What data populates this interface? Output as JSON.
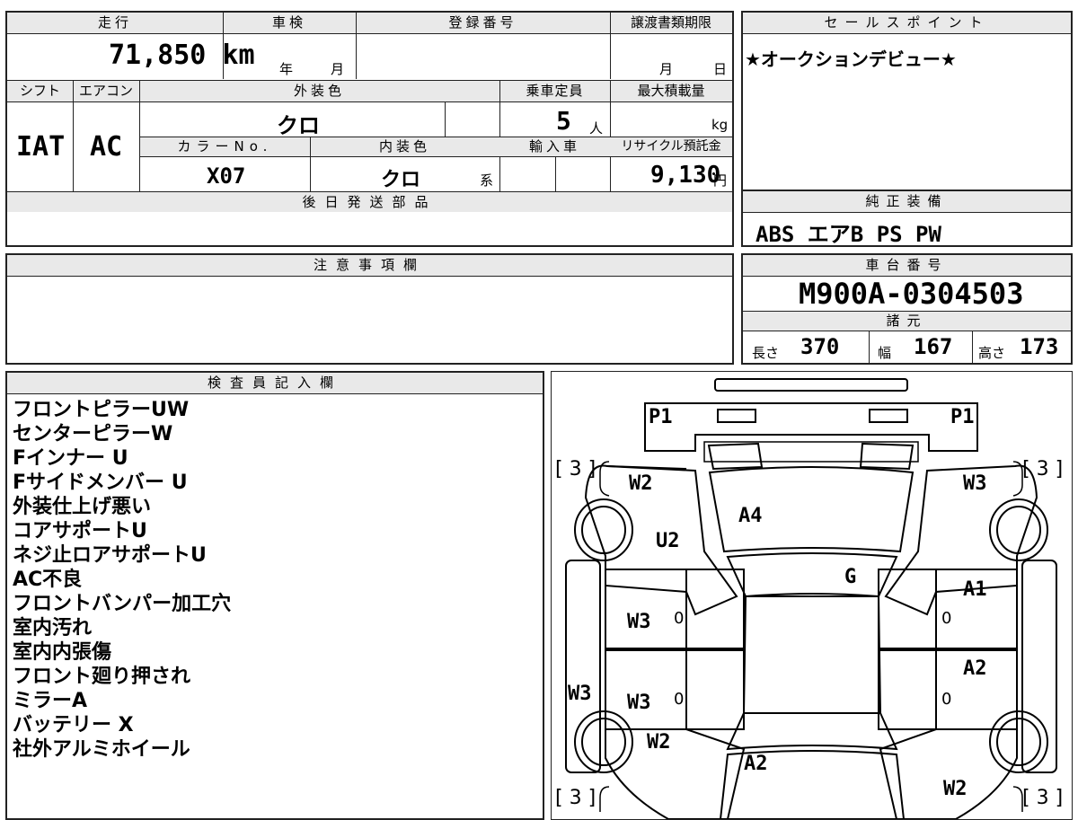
{
  "top_left": {
    "labels": {
      "mileage": "走行",
      "inspection": "車検",
      "registration": "登録番号",
      "transfer_deadline": "譲渡書類期限",
      "shift": "シフト",
      "aircon": "エアコン",
      "exterior_color": "外装色",
      "capacity": "乗車定員",
      "max_load": "最大積載量",
      "color_no": "カラーNo.",
      "interior_color": "内装色",
      "import": "輸入車",
      "recycle": "リサイクル預託金"
    },
    "values": {
      "mileage": "71,850 km",
      "year_unit": "年",
      "month_unit": "月",
      "deadline_month": "月",
      "deadline_day": "日",
      "shift": "IAT",
      "aircon": "AC",
      "exterior_color": "クロ",
      "capacity": "5",
      "capacity_unit": "人",
      "max_load_unit": "kg",
      "color_no": "X07",
      "interior_color": "クロ",
      "interior_suffix": "系",
      "recycle": "9,130",
      "recycle_unit": "円"
    }
  },
  "sales_point": {
    "label": "セールスポイント",
    "text": "★オークションデビュー★"
  },
  "later_parts": {
    "label": "後日発送部品"
  },
  "genuine_equipment": {
    "label": "純正装備",
    "text": "ABS エアB PS PW"
  },
  "caution": {
    "label": "注意事項欄"
  },
  "chassis": {
    "label": "車台番号",
    "number": "M900A-0304503",
    "spec_label": "諸元",
    "length_label": "長さ",
    "length": "370",
    "width_label": "幅",
    "width": "167",
    "height_label": "高さ",
    "height": "173"
  },
  "inspector": {
    "label": "検査員記入欄",
    "notes": [
      "フロントピラーUW",
      "センターピラーW",
      "Fインナー U",
      "Fサイドメンバー U",
      "外装仕上げ悪い",
      "コアサポートU",
      "ネジ止ロアサポートU",
      "AC不良",
      "フロントバンパー加工穴",
      "室内汚れ",
      "室内内張傷",
      "フロント廻り押され",
      "ミラーA",
      "バッテリー X",
      "社外アルミホイール"
    ]
  },
  "diagram": {
    "marks": {
      "p1_left": "P1",
      "p1_right": "P1",
      "w2_front_left": "W2",
      "w3_front_right": "W3",
      "a4": "A4",
      "u2": "U2",
      "g": "G",
      "a1": "A1",
      "w3_door_fl": "W3",
      "w3_door_rl": "W3",
      "a2_door_rr": "A2",
      "w3_side_left": "W3",
      "w2_rear_left": "W2",
      "a2_rear": "A2",
      "w2_rear_right": "W2",
      "zero_1": "0",
      "zero_2": "0",
      "zero_3": "0",
      "zero_4": "0"
    },
    "tires": {
      "front_left": "[ 3 ]",
      "front_right": "[ 3 ]",
      "rear_left": "[ 3 ]",
      "rear_right": "[ 3 ]"
    }
  }
}
